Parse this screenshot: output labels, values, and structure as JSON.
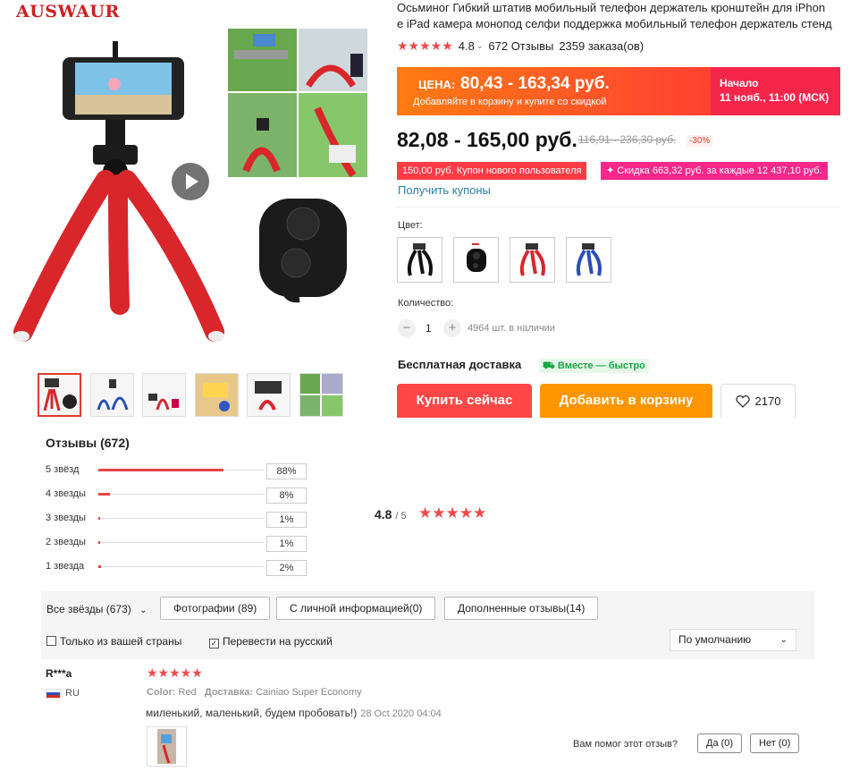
{
  "brand": "AUSWAUR",
  "product": {
    "title_line1": "Осьминог Гибкий штатив мобильный телефон держатель кронштейн для iPhon",
    "title_line2": "e iPad камера монопод селфи поддержка мобильный телефон держатель стенд",
    "rating": "4.8",
    "reviews_count": "672 Отзывы",
    "orders": "2359 заказа(ов)"
  },
  "promo": {
    "label": "ЦЕНА:",
    "price": "80,43 - 163,34 руб.",
    "subtitle": "Добавляйте в корзину и купите со скидкой",
    "start_label": "Начало",
    "start_date": "11 нояб., 11:00 (МСК)"
  },
  "price": {
    "current": "82,08 - 165,00 руб.",
    "old": "116,91 - 236,30 руб.",
    "discount": "-30%"
  },
  "coupons": {
    "new_user": "150,00 руб. Купон нового пользователя",
    "store": "✦ Скидка 663,32 руб. за каждые 12 437,10 руб.",
    "get_link": "Получить купоны"
  },
  "color_label": "Цвет:",
  "quantity": {
    "label": "Количество:",
    "value": "1",
    "minus": "−",
    "plus": "+",
    "stock": "4964 шт. в наличии"
  },
  "shipping": {
    "label": "Бесплатная доставка",
    "badge": "Вместе — быстро"
  },
  "actions": {
    "buy": "Купить сейчас",
    "cart": "Добавить в корзину",
    "wishlist_count": "2170"
  },
  "reviews": {
    "title": "Отзывы (672)",
    "histogram": [
      {
        "label": "5 звёзд",
        "pct": "88%",
        "value": 88
      },
      {
        "label": "4 звезды",
        "pct": "8%",
        "value": 8
      },
      {
        "label": "3 звезды",
        "pct": "1%",
        "value": 1
      },
      {
        "label": "2 звезды",
        "pct": "1%",
        "value": 1
      },
      {
        "label": "1 звезда",
        "pct": "2%",
        "value": 2
      }
    ],
    "average": "4.8",
    "average_max": "/ 5",
    "filters": {
      "all_stars": "Все звёзды (673)",
      "photos": "Фотографии (89)",
      "personal": "С личной информацией(0)",
      "additional": "Дополненные отзывы(14)",
      "own_country": "Только из вашей страны",
      "translate": "Перевести на русский",
      "sort": "По умолчанию"
    },
    "items": [
      {
        "name": "R***a",
        "country": "RU",
        "color_label": "Color:",
        "color": "Red",
        "delivery_label": "Доставка:",
        "delivery": "Cainiao Super Economy",
        "text": "миленький, маленький, будем пробовать!)",
        "date": "28 Oct 2020 04:04",
        "helpful_q": "Вам помог этот отзыв?",
        "yes": "Да (0)",
        "no": "Нет (0)"
      }
    ]
  },
  "colors": {
    "accent": "#ff4747",
    "cart": "#ff9500",
    "stars": "#f04a4a",
    "link": "#2d7fa7"
  }
}
